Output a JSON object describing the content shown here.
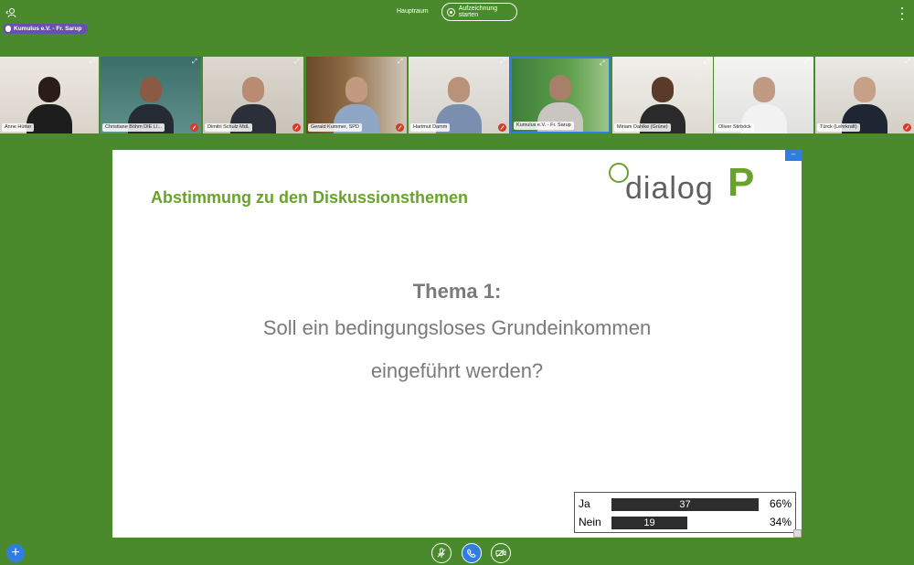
{
  "topbar": {
    "room_name": "Hauptraum",
    "record_label": "Aufzeichnung starten"
  },
  "presenter": {
    "label": "Kumulus e.V. - Fr. Sarup"
  },
  "participants": [
    {
      "name": "Anne Hütter"
    },
    {
      "name": "Christiane Böhm DIE LI..."
    },
    {
      "name": "Dimitri Schulz MdL"
    },
    {
      "name": "Gerald Kummer, SPD"
    },
    {
      "name": "Hartmut Damm"
    },
    {
      "name": "Kumulus e.V. - Fr. Sarup"
    },
    {
      "name": "Miriam Dahlke (Grüne)"
    },
    {
      "name": "Oliver Stirböck"
    },
    {
      "name": "Türck (Lehrkraft)"
    }
  ],
  "slide": {
    "title": "Abstimmung zu den Diskussionsthemen",
    "logo_text": "dialog",
    "logo_letter": "P",
    "theme": "Thema 1:",
    "question_line1": "Soll ein bedingungsloses Grundeinkommen",
    "question_line2": "eingeführt werden?"
  },
  "poll": {
    "rows": [
      {
        "label": "Ja",
        "count": "37",
        "percent": "66%",
        "fraction": 0.66
      },
      {
        "label": "Nein",
        "count": "19",
        "percent": "34%",
        "fraction": 0.34
      }
    ]
  },
  "icons": {
    "user_list": "user-icon",
    "record": "record-icon",
    "mic": "microphone-muted-icon",
    "phone": "phone-icon",
    "camera": "camera-off-icon",
    "add": "plus-icon",
    "expand": "expand-icon"
  },
  "colors": {
    "background": "#4a8a2d",
    "accent": "#2f7de1",
    "badge": "#6a4fb0",
    "slide_title": "#6aa32c",
    "mute": "#d43b2a"
  }
}
